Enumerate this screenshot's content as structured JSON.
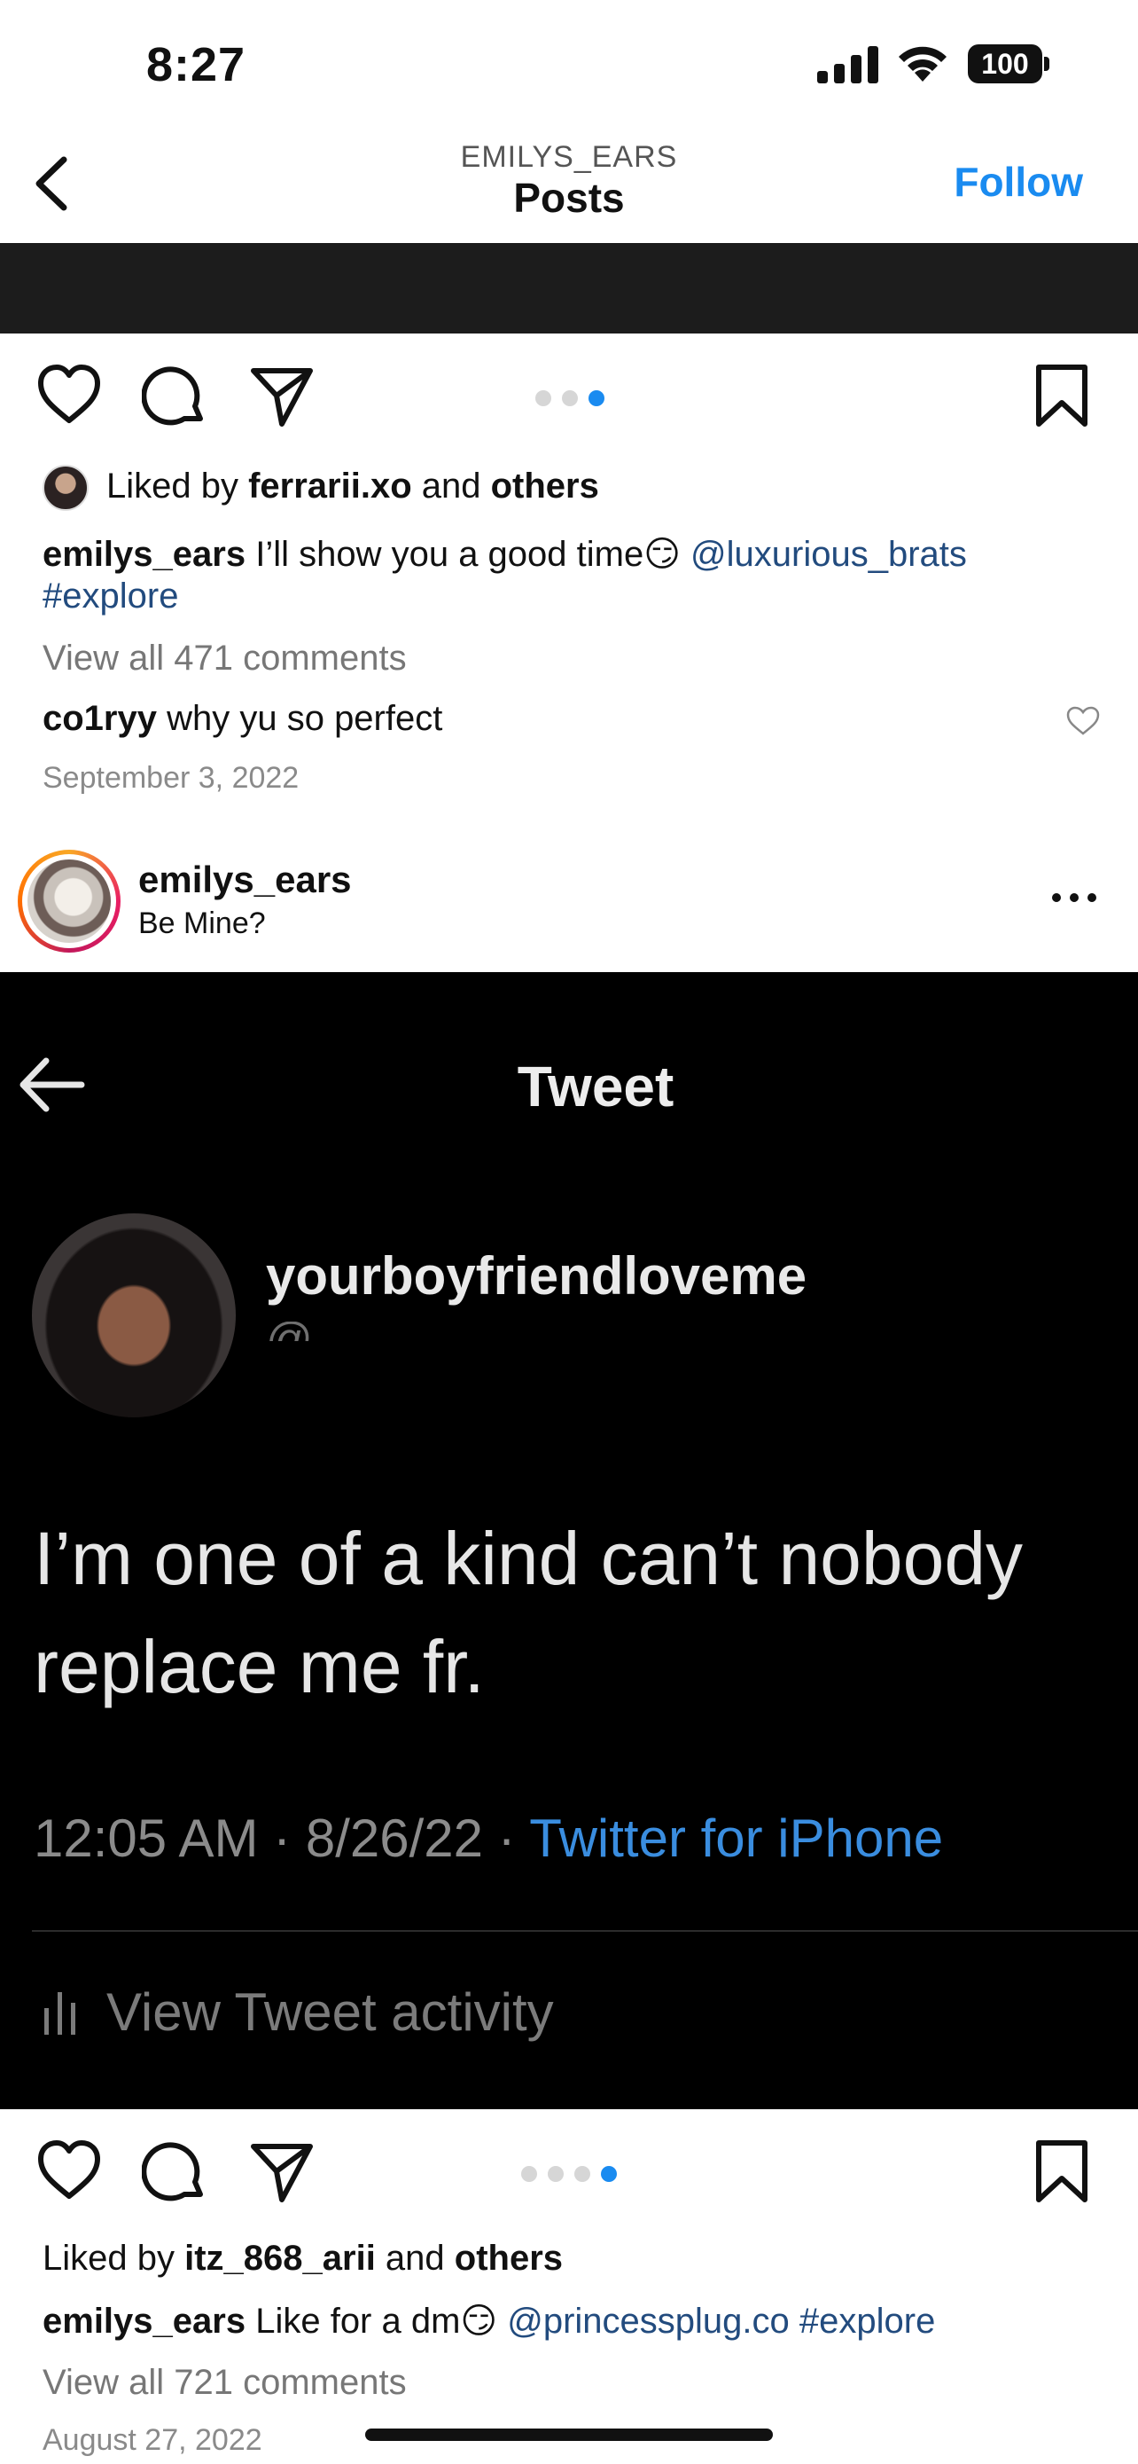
{
  "status_bar": {
    "time": "8:27",
    "battery": "100"
  },
  "nav": {
    "subtitle": "EMILYS_EARS",
    "title": "Posts",
    "follow_label": "Follow"
  },
  "post1": {
    "liked_prefix": "Liked by ",
    "liked_user": "ferrarii.xo",
    "liked_and": " and ",
    "liked_others": "others",
    "caption_user": "emilys_ears",
    "caption_text": " I’ll show you a good time😏 ",
    "caption_mention": "@luxurious_brats",
    "caption_tag": "#explore",
    "view_comments": "View all 471 comments",
    "comment_user": "co1ryy",
    "comment_text": " why yu so perfect",
    "date": "September 3, 2022",
    "carousel_active": 3,
    "carousel_count": 3
  },
  "post2": {
    "username": "emilys_ears",
    "location": "Be Mine?",
    "tweet": {
      "header": "Tweet",
      "name": "yourboyfriendloveme",
      "text_line1": "I’m one of a kind can’t nobody",
      "text_line2": "replace me fr.",
      "meta": "12:05 AM · 8/26/22 · ",
      "source": "Twitter for iPhone",
      "activity": "View Tweet activity"
    },
    "liked_prefix": "Liked by ",
    "liked_user": "itz_868_arii",
    "liked_and": " and ",
    "liked_others": "others",
    "caption_user": "emilys_ears",
    "caption_text": " Like for a dm😏 ",
    "caption_mention": "@princessplug.co",
    "caption_tag": "#explore",
    "view_comments": "View all 721 comments",
    "date": "August 27, 2022",
    "carousel_active": 4,
    "carousel_count": 4
  },
  "colors": {
    "accent": "#1a8bf0",
    "link": "#224b7e",
    "dark_bg": "#000000"
  }
}
